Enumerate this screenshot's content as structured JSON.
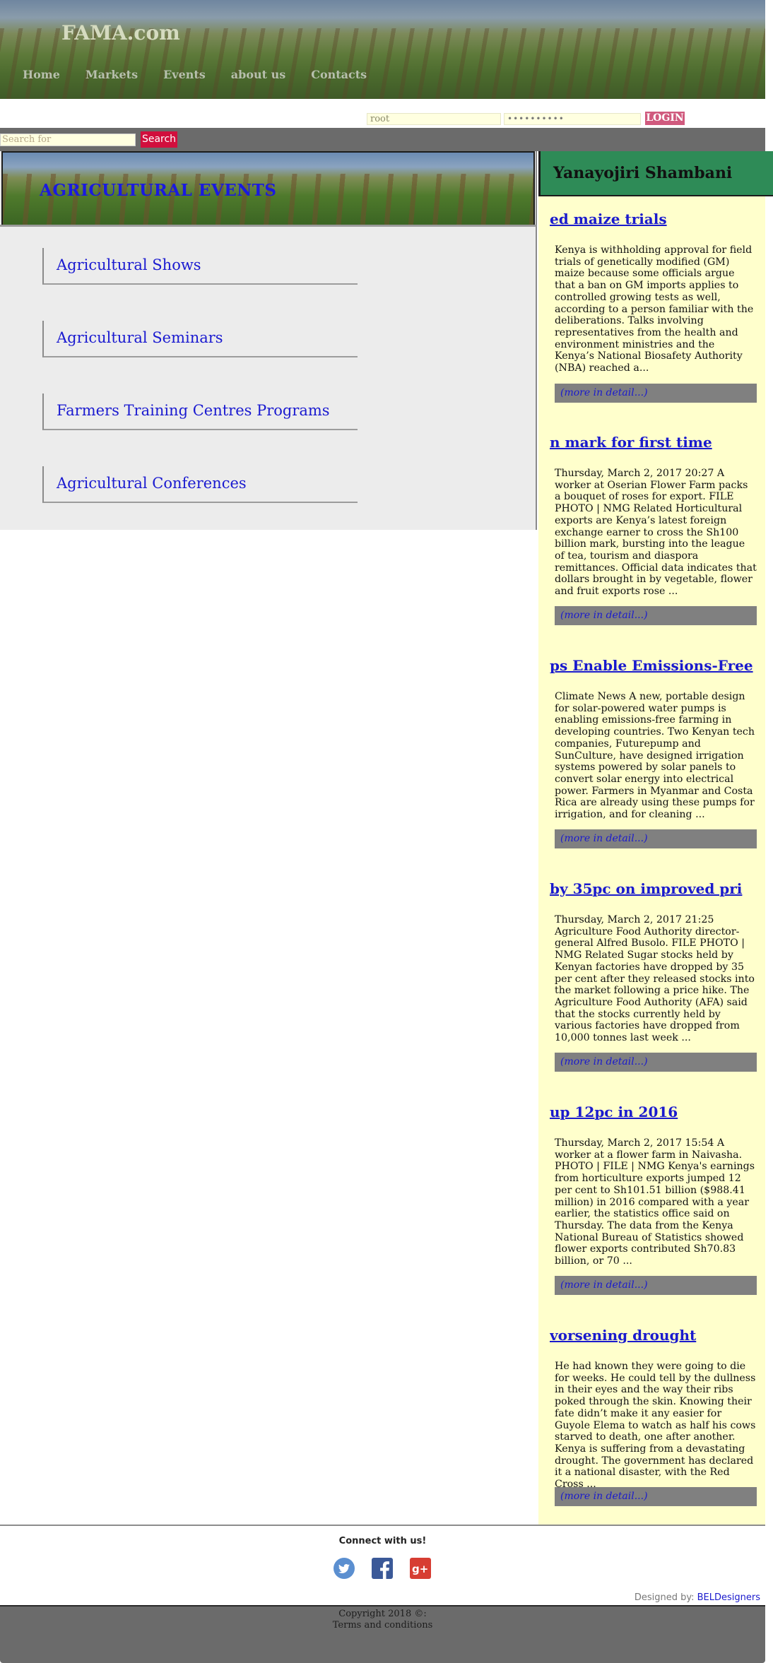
{
  "header": {
    "logo": "FAMA.com",
    "nav": [
      "Home",
      "Markets",
      "Events",
      "about us",
      "Contacts"
    ]
  },
  "login": {
    "username": "root",
    "password_mask": "••••••••••",
    "button": "LOGIN"
  },
  "search": {
    "placeholder": "Search for",
    "button": "Search"
  },
  "main": {
    "banner_title": "AGRICULTURAL EVENTS",
    "categories": [
      "Agricultural Shows",
      "Agricultural Seminars",
      "Farmers Training Centres Programs",
      "Agricultural Conferences"
    ]
  },
  "sidebar": {
    "title": "Yanayojiri Shambani",
    "more_label": "(more in detail...)",
    "news": [
      {
        "title": "ed maize trials",
        "body": "Kenya is withholding approval for field trials of genetically modified (GM) maize because some officials argue that a ban on GM imports applies to controlled growing tests as well, according to a person familiar with the deliberations. Talks involving representatives from the health and environment ministries and the Kenya’s National Biosafety Authority (NBA) reached a..."
      },
      {
        "title": "n mark for first time",
        "body": "Thursday, March 2, 2017 20:27 A worker at Oserian Flower Farm packs a bouquet of roses for export. FILE PHOTO | NMG Related Horticultural exports are Kenya’s latest foreign exchange earner to cross the Sh100 billion mark, bursting into the league of tea, tourism and diaspora remittances. Official data indicates that dollars brought in by vegetable, flower and fruit exports rose ..."
      },
      {
        "title": "ps Enable Emissions-Free",
        "body": "Climate News A new, portable design for solar-powered water pumps is enabling emissions-free farming in developing countries. Two Kenyan tech companies, Futurepump and SunCulture, have designed irrigation systems powered by solar panels to convert solar energy into electrical power. Farmers in Myanmar and Costa Rica are already using these pumps for irrigation, and for cleaning ..."
      },
      {
        "title": "by 35pc on improved pri",
        "body": "Thursday, March 2, 2017 21:25 Agriculture Food Authority director-general Alfred Busolo. FILE PHOTO | NMG Related Sugar stocks held by Kenyan factories have dropped by 35 per cent after they released stocks into the market following a price hike. The Agriculture Food Authority (AFA) said that the stocks currently held by various factories have dropped from 10,000 tonnes last week ..."
      },
      {
        "title": "up 12pc in 2016",
        "body": "Thursday, March 2, 2017 15:54 A worker at a flower farm in Naivasha. PHOTO | FILE | NMG Kenya's earnings from horticulture exports jumped 12 per cent to Sh101.51 billion ($988.41 million) in 2016 compared with a year earlier, the statistics office said on Thursday. The data from the Kenya National Bureau of Statistics showed flower exports contributed Sh70.83 billion, or 70 ..."
      },
      {
        "title": "vorsening drought",
        "body": "He had known they were going to die for weeks. He could tell by the dullness in their eyes and the way their ribs poked through the skin. Knowing their fate didn’t make it any easier for Guyole Elema to watch as half his cows starved to death, one after another. Kenya is suffering from a devastating drought. The government has declared it a national disaster, with the Red Cross ..."
      }
    ]
  },
  "footer": {
    "connect": "Connect with us!",
    "social": [
      "twitter-icon",
      "facebook-icon",
      "google-plus-icon"
    ],
    "designed_by_label": "Designed by:",
    "designed_by": "BELDesigners",
    "copyright": "Copyright 2018 ©:",
    "terms": "Terms and conditions"
  },
  "colors": {
    "sidebar_bg": "#ffffcc",
    "sidebar_head": "#2e8b57",
    "link": "#1a1acd",
    "search_button": "#d10f3d",
    "login_button": "#d05a7e"
  }
}
